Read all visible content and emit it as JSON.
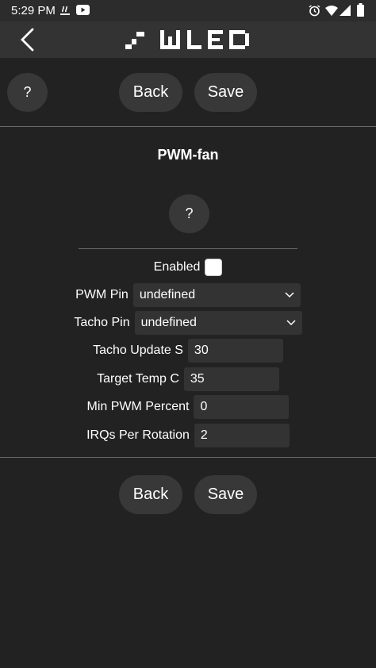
{
  "status": {
    "time": "5:29 PM"
  },
  "header": {
    "back_icon": "chevron-left-icon",
    "logo_text": "WLED"
  },
  "top_buttons": {
    "help": "?",
    "back": "Back",
    "save": "Save"
  },
  "section": {
    "title": "PWM-fan",
    "help": "?"
  },
  "form": {
    "enabled_label": "Enabled",
    "enabled_checked": false,
    "pwm_pin_label": "PWM Pin",
    "pwm_pin_value": "undefined",
    "tacho_pin_label": "Tacho Pin",
    "tacho_pin_value": "undefined",
    "tacho_update_label": "Tacho Update S",
    "tacho_update_value": "30",
    "target_temp_label": "Target Temp C",
    "target_temp_value": "35",
    "min_pwm_label": "Min PWM Percent",
    "min_pwm_value": "0",
    "irqs_label": "IRQs Per Rotation",
    "irqs_value": "2"
  },
  "bottom_buttons": {
    "back": "Back",
    "save": "Save"
  },
  "colors": {
    "background": "#222222",
    "button": "#383838",
    "input": "#333333",
    "text": "#ffffff"
  }
}
